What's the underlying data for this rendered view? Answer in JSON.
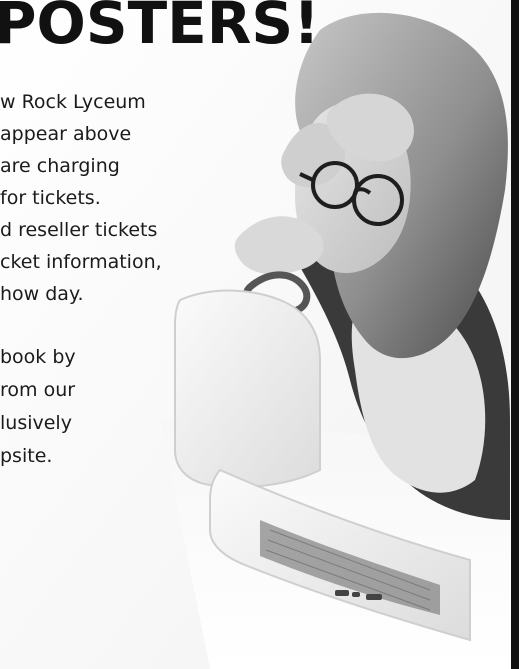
{
  "headline": "POSTERS!",
  "paragraph1": [
    "w Rock Lyceum",
    "appear above",
    "are charging",
    "for tickets.",
    "d reseller tickets",
    "cket information,",
    "how day."
  ],
  "paragraph2": [
    "book by",
    "rom our",
    "lusively",
    "psite."
  ],
  "photo": {
    "subject": "woman-frustrated-at-laptop",
    "palette": [
      "#f3f3f3",
      "#d9d9d9",
      "#9a9a9a",
      "#5c5c5c",
      "#2b2b2b"
    ]
  }
}
